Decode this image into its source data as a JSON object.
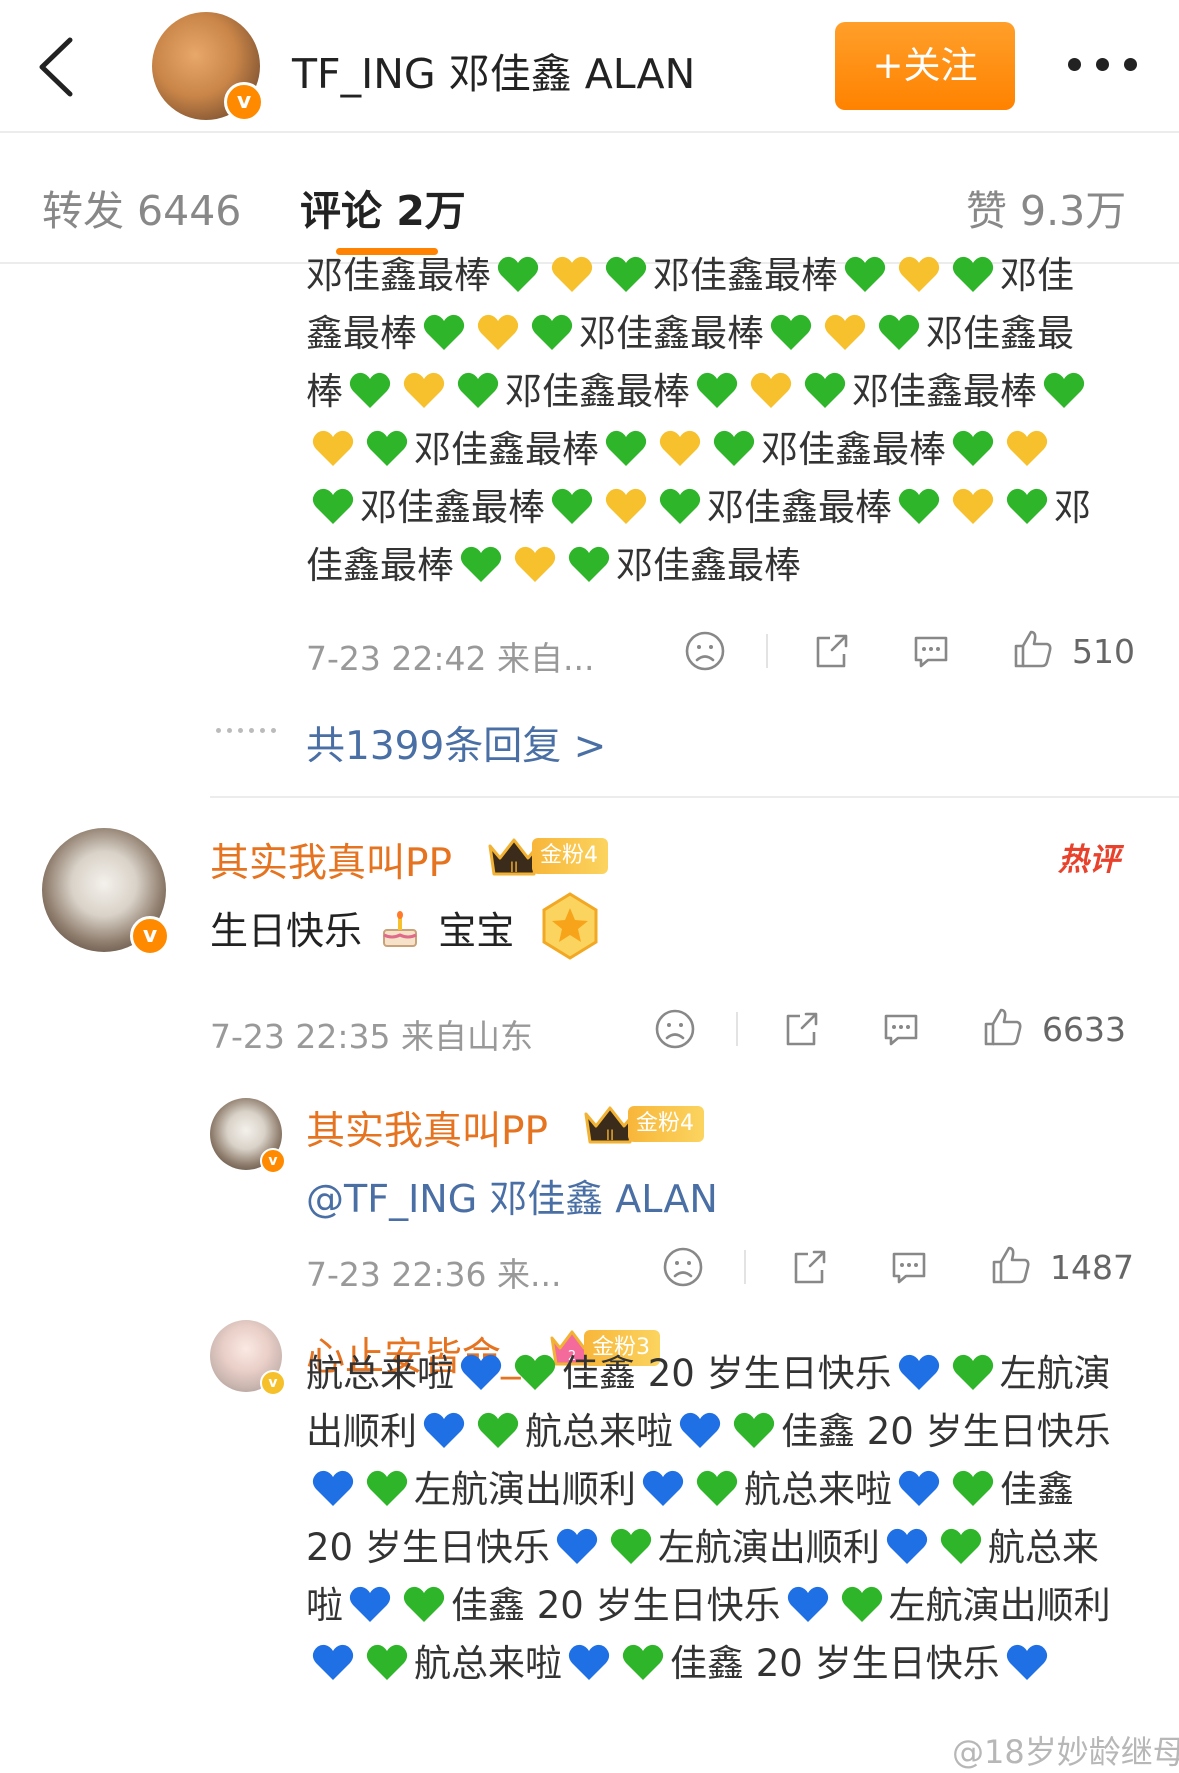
{
  "header": {
    "title": "TF_ING 邓佳鑫 ALAN",
    "follow_label": "+关注"
  },
  "tabs": {
    "repost": "转发 6446",
    "comments": "评论 2万",
    "likes": "赞 9.3万"
  },
  "comment1": {
    "lines": [
      [
        "邓佳鑫最棒",
        "G",
        "Y",
        "G",
        "邓佳鑫最棒",
        "G",
        "Y",
        "G",
        "邓佳"
      ],
      [
        "鑫最棒",
        "G",
        "Y",
        "G",
        "邓佳鑫最棒",
        "G",
        "Y",
        "G",
        "邓佳鑫最"
      ],
      [
        "棒",
        "G",
        "Y",
        "G",
        "邓佳鑫最棒",
        "G",
        "Y",
        "G",
        "邓佳鑫最棒",
        "G"
      ],
      [
        "Y",
        "G",
        "邓佳鑫最棒",
        "G",
        "Y",
        "G",
        "邓佳鑫最棒",
        "G",
        "Y"
      ],
      [
        "G",
        "邓佳鑫最棒",
        "G",
        "Y",
        "G",
        "邓佳鑫最棒",
        "G",
        "Y",
        "G",
        "邓"
      ],
      [
        "佳鑫最棒",
        "G",
        "Y",
        "G",
        "邓佳鑫最棒"
      ]
    ],
    "meta": "7-23 22:42 来自...",
    "likes": "510",
    "replies_link": "共1399条回复 >"
  },
  "comment2": {
    "username": "其实我真叫PP",
    "fan_badge": "金粉4",
    "hot_label": "热评",
    "text_before": "生日快乐",
    "text_after": "宝宝",
    "meta": "7-23 22:35 来自山东",
    "likes": "6633"
  },
  "reply1": {
    "username": "其实我真叫PP",
    "fan_badge": "金粉4",
    "mention": "@TF_ING 邓佳鑫 ALAN",
    "meta": "7-23 22:36 来...",
    "likes": "1487"
  },
  "reply2": {
    "username": "心止安皆命_",
    "fan_badge": "金粉3",
    "lines": [
      [
        "航总来啦",
        "B",
        "G",
        "佳鑫 20 岁生日快乐",
        "B",
        "G",
        "左航演"
      ],
      [
        "出顺利",
        "B",
        "G",
        "航总来啦",
        "B",
        "G",
        "佳鑫 20 岁生日快乐"
      ],
      [
        "B",
        "G",
        "左航演出顺利",
        "B",
        "G",
        "航总来啦",
        "B",
        "G",
        "佳鑫"
      ],
      [
        "20 岁生日快乐",
        "B",
        "G",
        "左航演出顺利",
        "B",
        "G",
        "航总来"
      ],
      [
        "啦",
        "B",
        "G",
        "佳鑫 20 岁生日快乐",
        "B",
        "G",
        "左航演出顺利"
      ],
      [
        "B",
        "G",
        "航总来啦",
        "B",
        "G",
        "佳鑫 20 岁生日快乐",
        "B"
      ]
    ]
  },
  "watermark": "@18岁妙龄继母",
  "colors": {
    "accent": "#ff8200",
    "username": "#e5731f",
    "link": "#4a6fa5",
    "hot": "#e8412c",
    "heart_green": "#2fb52a",
    "heart_yellow": "#f6c12d",
    "heart_blue": "#1f6fe5"
  },
  "icons": {
    "heart_codes": {
      "G": "green-heart-icon",
      "Y": "yellow-heart-icon",
      "B": "blue-heart-icon"
    }
  }
}
